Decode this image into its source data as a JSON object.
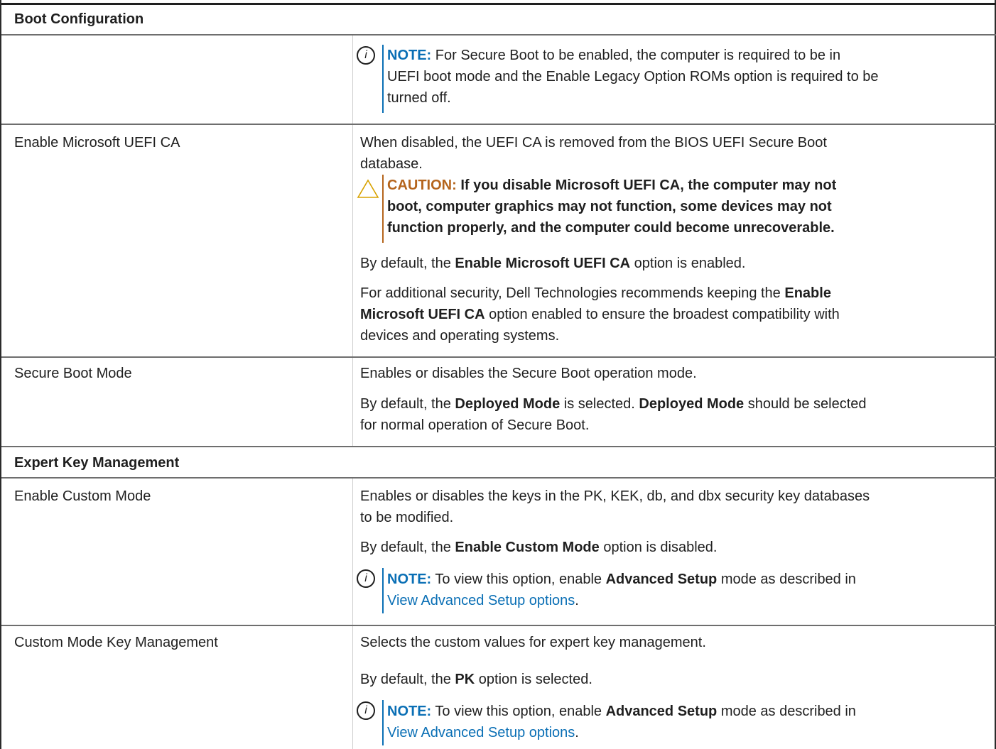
{
  "table": {
    "sections": [
      {
        "title": "Boot Configuration"
      },
      {
        "title": "Expert Key Management"
      }
    ],
    "rows": [
      {
        "setting": "",
        "note": {
          "label": "NOTE:",
          "lines": [
            "For Secure Boot to be enabled, the computer is required to be in",
            "UEFI boot mode and the Enable Legacy Option ROMs option is required to be",
            "turned off."
          ]
        }
      },
      {
        "setting": "Enable Microsoft UEFI CA",
        "desc1": [
          "When disabled, the UEFI CA is removed from the BIOS UEFI Secure Boot",
          "database."
        ],
        "caution": {
          "label": "CAUTION:",
          "lines": [
            "If you disable Microsoft UEFI CA, the computer may not",
            "boot, computer graphics may not function, some devices may not",
            "function properly, and the computer could become unrecoverable."
          ]
        },
        "default": {
          "pre": "By default, the ",
          "bold": "Enable Microsoft UEFI CA",
          "post": " option is enabled."
        },
        "extra": {
          "l1_pre": "For additional security, Dell Technologies recommends keeping the ",
          "l1_bold": "Enable",
          "l2_bold": "Microsoft UEFI CA",
          "l2_post": " option enabled to ensure the broadest compatibility with",
          "l3": "devices and operating systems."
        }
      },
      {
        "setting": "Secure Boot Mode",
        "desc1": "Enables or disables the Secure Boot operation mode.",
        "default": {
          "pre": "By default, the ",
          "bold": "Deployed Mode",
          "mid": " is selected. ",
          "bold2": "Deployed Mode",
          "post": " should be selected",
          "line2": "for normal operation of Secure Boot."
        }
      },
      {
        "setting": "Enable Custom Mode",
        "desc1": [
          "Enables or disables the keys in the PK, KEK, db, and dbx security key databases",
          "to be modified."
        ],
        "default": {
          "pre": "By default, the ",
          "bold": "Enable Custom Mode",
          "post": " option is disabled."
        },
        "note": {
          "label": "NOTE:",
          "pre": " To view this option, enable ",
          "bold": "Advanced Setup",
          "post": " mode as described in",
          "link": "View Advanced Setup options",
          "end": "."
        }
      },
      {
        "setting": "Custom Mode Key Management",
        "desc1": "Selects the custom values for expert key management.",
        "default": {
          "pre": "By default, the ",
          "bold": "PK",
          "post": " option is selected."
        },
        "note": {
          "label": "NOTE:",
          "pre": " To view this option, enable ",
          "bold": "Advanced Setup",
          "post": " mode as described in",
          "link": "View Advanced Setup options",
          "end": "."
        }
      }
    ]
  },
  "colors": {
    "note_accent": "#0a6fb5",
    "caution_accent": "#b5651d",
    "text": "#1f1f1f"
  },
  "icons": {
    "note": "info-icon",
    "caution": "warning-icon"
  }
}
